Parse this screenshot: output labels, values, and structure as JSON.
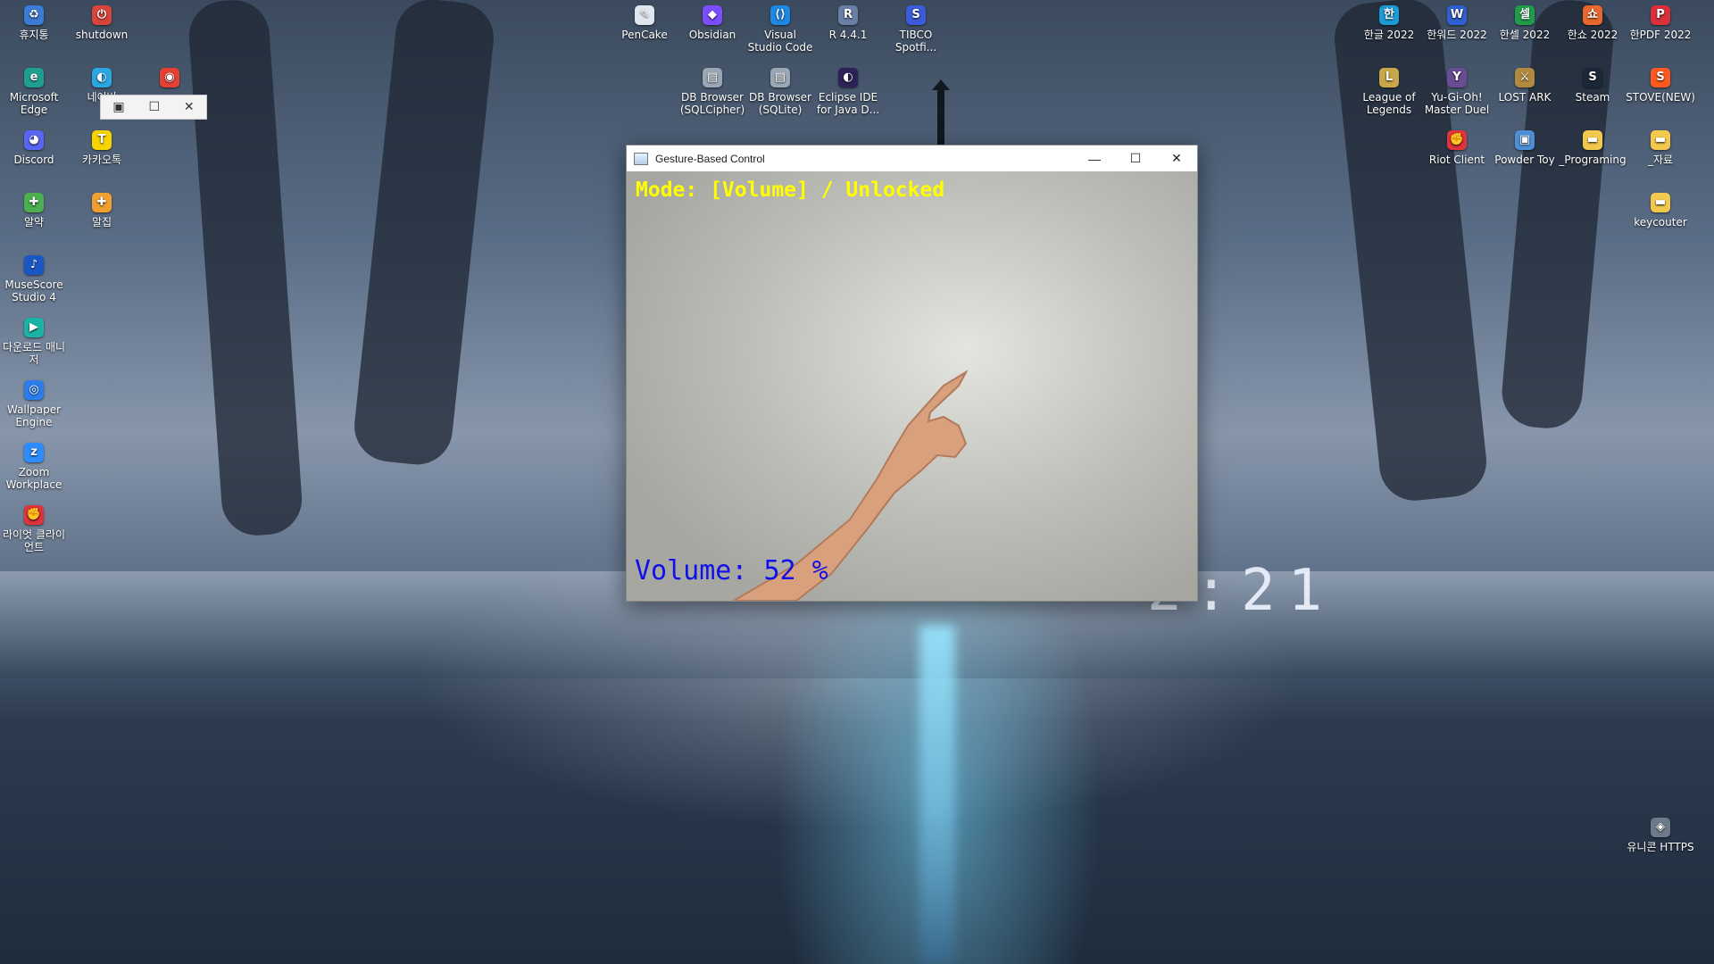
{
  "clock": "2:21",
  "desktop_icons": [
    {
      "label": "휴지통",
      "color": "#3a7bd5",
      "glyph": "♻",
      "icon": "recycle-bin-icon"
    },
    {
      "label": "shutdown",
      "color": "#d9443a",
      "glyph": "⏻",
      "icon": "shutdown-icon"
    },
    {
      "label": "Microsoft Edge",
      "color": "#1e9e8f",
      "glyph": "e",
      "icon": "edge-icon"
    },
    {
      "label": "네이버",
      "color": "#2aa6e0",
      "glyph": "◐",
      "icon": "naver-whale-icon"
    },
    {
      "label": "",
      "color": "#e44134",
      "glyph": "◉",
      "icon": "chrome-icon"
    },
    {
      "label": "Discord",
      "color": "#5865f2",
      "glyph": "◕",
      "icon": "discord-icon"
    },
    {
      "label": "카카오톡",
      "color": "#f6d400",
      "glyph": "T",
      "icon": "kakaotalk-icon"
    },
    {
      "label": "알약",
      "color": "#4caf50",
      "glyph": "✚",
      "icon": "alyac-icon"
    },
    {
      "label": "알집",
      "color": "#f0a030",
      "glyph": "✚",
      "icon": "alzip-icon"
    },
    {
      "label": "MuseScore Studio 4",
      "color": "#1a56c4",
      "glyph": "♪",
      "icon": "musescore-icon"
    },
    {
      "label": "다운로드 매니저",
      "color": "#19b4a6",
      "glyph": "▶",
      "icon": "download-manager-icon"
    },
    {
      "label": "Wallpaper Engine",
      "color": "#2b7de9",
      "glyph": "◎",
      "icon": "wallpaper-engine-icon"
    },
    {
      "label": "Zoom Workplace",
      "color": "#2d8cff",
      "glyph": "z",
      "icon": "zoom-icon"
    },
    {
      "label": "라이엇 클라이언트",
      "color": "#e0333c",
      "glyph": "✊",
      "icon": "riot-client-icon"
    },
    {
      "label": "PenCake",
      "color": "#dfe6ee",
      "glyph": "✎",
      "icon": "pencake-icon"
    },
    {
      "label": "Obsidian",
      "color": "#7c4dff",
      "glyph": "◆",
      "icon": "obsidian-icon"
    },
    {
      "label": "Visual Studio Code",
      "color": "#1e88e5",
      "glyph": "⟨⟩",
      "icon": "vscode-icon"
    },
    {
      "label": "R 4.4.1",
      "color": "#6b7fa6",
      "glyph": "R",
      "icon": "r-icon"
    },
    {
      "label": "TIBCO Spotfi...",
      "color": "#3b5bdb",
      "glyph": "S",
      "icon": "tibco-spotfire-icon"
    },
    {
      "label": "DB Browser (SQLCipher)",
      "color": "#9aa7b5",
      "glyph": "▤",
      "icon": "db-browser-sqlcipher-icon"
    },
    {
      "label": "DB Browser (SQLite)",
      "color": "#9aa7b5",
      "glyph": "▤",
      "icon": "db-browser-sqlite-icon"
    },
    {
      "label": "Eclipse IDE for Java D...",
      "color": "#2c2255",
      "glyph": "◐",
      "icon": "eclipse-icon"
    },
    {
      "label": "한글 2022",
      "color": "#1d9bd7",
      "glyph": "한",
      "icon": "hangul-icon"
    },
    {
      "label": "한워드 2022",
      "color": "#2f5fd0",
      "glyph": "W",
      "icon": "hanword-icon"
    },
    {
      "label": "한셀 2022",
      "color": "#1f9e4a",
      "glyph": "셀",
      "icon": "hancell-icon"
    },
    {
      "label": "한쇼 2022",
      "color": "#e8672c",
      "glyph": "쇼",
      "icon": "hanshow-icon"
    },
    {
      "label": "한PDF 2022",
      "color": "#d9303a",
      "glyph": "P",
      "icon": "hanpdf-icon"
    },
    {
      "label": "League of Legends",
      "color": "#c8a64b",
      "glyph": "L",
      "icon": "league-of-legends-icon"
    },
    {
      "label": "Yu-Gi-Oh! Master Duel",
      "color": "#6a4c93",
      "glyph": "Y",
      "icon": "yugioh-icon"
    },
    {
      "label": "LOST ARK",
      "color": "#b08a3e",
      "glyph": "⚔",
      "icon": "lost-ark-icon"
    },
    {
      "label": "Steam",
      "color": "#1b2838",
      "glyph": "S",
      "icon": "steam-icon"
    },
    {
      "label": "STOVE(NEW)",
      "color": "#ff5a1f",
      "glyph": "S",
      "icon": "stove-icon"
    },
    {
      "label": "Riot Client",
      "color": "#e0333c",
      "glyph": "✊",
      "icon": "riot-client-icon"
    },
    {
      "label": "Powder Toy",
      "color": "#4d8fd6",
      "glyph": "▣",
      "icon": "powder-toy-icon"
    },
    {
      "label": "_Programing",
      "color": "#f2c94c",
      "glyph": "▬",
      "icon": "folder-icon"
    },
    {
      "label": "_자료",
      "color": "#f2c94c",
      "glyph": "▬",
      "icon": "folder-icon"
    },
    {
      "label": "keycouter",
      "color": "#f2c94c",
      "glyph": "▬",
      "icon": "folder-icon"
    },
    {
      "label": "유니콘 HTTPS",
      "color": "#6c7a89",
      "glyph": "◈",
      "icon": "unicorn-https-icon"
    }
  ],
  "mini_window": {
    "restore": "□",
    "maximize": "☐",
    "close": "✕"
  },
  "window": {
    "title": "Gesture-Based Control",
    "minimize": "—",
    "maximize": "☐",
    "close": "✕",
    "mode_text": "Mode: [Volume] / Unlocked",
    "volume_text": "Volume: 52 %"
  }
}
